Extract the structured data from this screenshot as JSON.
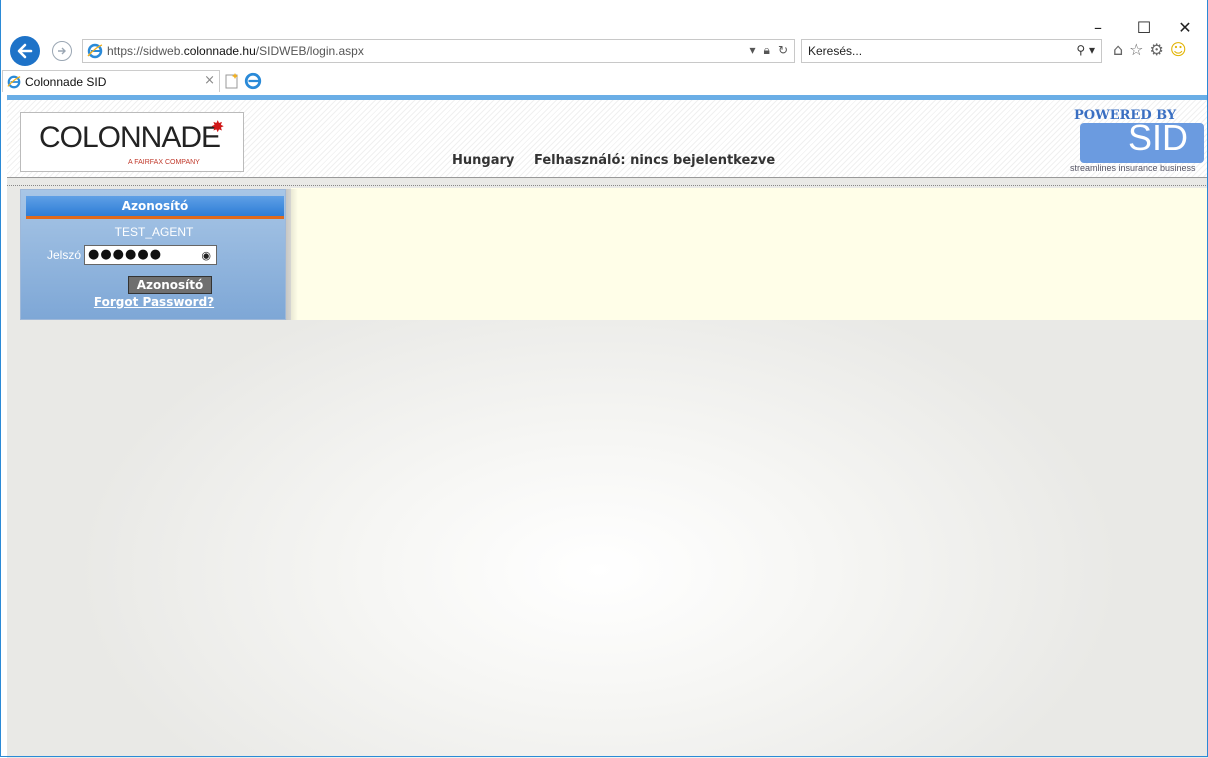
{
  "browser": {
    "url_prefix": "https://sidweb.",
    "url_host": "colonnade.hu",
    "url_path": "/SIDWEB/login.aspx",
    "search_placeholder": "Keresés...",
    "tab_title": "Colonnade SID",
    "window_controls": {
      "minimize": "–",
      "maximize": "☐",
      "close": "✕"
    }
  },
  "header": {
    "logo_text": "COLONNADE",
    "logo_subtext": "A FAIRFAX COMPANY",
    "country": "Hungary",
    "user_status": "Felhasználó: nincs bejelentkezve",
    "sid_powered": "POWERED BY",
    "sid_text": "SID",
    "sid_tagline": "streamlines insurance business"
  },
  "login": {
    "title": "Azonosító",
    "username": "TEST_AGENT",
    "password_label": "Jelszó",
    "password_value": "●●●●●●",
    "submit_label": "Azonosító",
    "forgot_label": "Forgot Password?"
  },
  "icons": {
    "back": "back-arrow-icon",
    "forward": "forward-arrow-icon",
    "home": "home-icon",
    "favorites": "star-icon",
    "settings": "gear-icon",
    "smiley": "smiley-icon",
    "ie": "ie-logo-icon",
    "eye": "eye-icon"
  },
  "colors": {
    "brand_blue": "#2e7dd6",
    "accent_orange": "#e06a1c",
    "content_bg": "#fffee8"
  }
}
